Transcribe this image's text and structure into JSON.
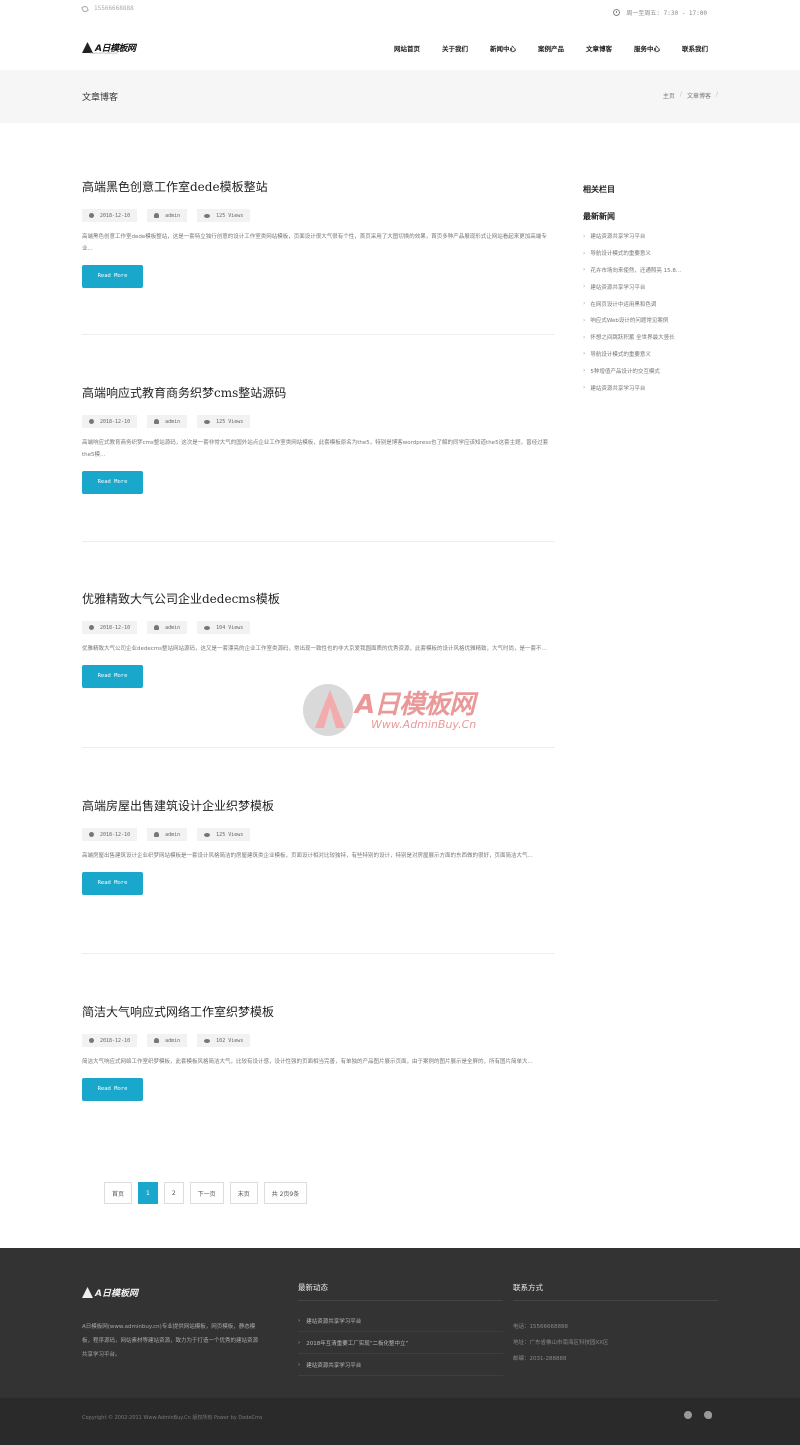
{
  "topbar": {
    "phone": "15566668888",
    "hours": "周一至周五: 7:30 - 17:00"
  },
  "header": {
    "logo_text": "A日模板网",
    "logo_sub": "Www.AdminBuy.Cn",
    "nav": [
      "网站首页",
      "关于我们",
      "新闻中心",
      "案例产品",
      "文章博客",
      "服务中心",
      "联系我们"
    ]
  },
  "page": {
    "title": "文章博客",
    "breadcrumb": [
      "主页",
      "文章博客"
    ]
  },
  "posts": [
    {
      "title": "高端黑色创意工作室dede模板整站",
      "date": "2018-12-10",
      "author": "admin",
      "views": "125 Views",
      "excerpt": "高端黑色创意工作室dede模板整站，这是一套特立独行创意的设计工作室类网站模板，页面设计很大气很有个性，首页采用了大图切换的效果，首页多种产品展现形式让网站看起来更加高端专业...",
      "button": "Read More"
    },
    {
      "title": "高端响应式教育商务织梦cms整站源码",
      "date": "2018-12-10",
      "author": "admin",
      "views": "125 Views",
      "excerpt": "高端响应式教育商务织梦cms整站源码，这次是一套非常大气的国外站点企业工作室类网站模板，此套模板原名为the5，特别是博客wordpress也了解的同学应该知道the5这套主题，曾经过套the5模...",
      "button": "Read More"
    },
    {
      "title": "优雅精致大气公司企业dedecms模板",
      "date": "2018-12-10",
      "author": "admin",
      "views": "104 Views",
      "excerpt": "优雅精致大气公司企业dedecms整站网站源码，这又是一套漂亮的企业工作室类源码，常出现一致性也的非大京爱我圆面质的优秀资源，此套模板的设计风格优雅精致，大气时尚，是一套不...",
      "button": "Read More"
    },
    {
      "title": "高端房屋出售建筑设计企业织梦模板",
      "date": "2018-12-10",
      "author": "admin",
      "views": "125 Views",
      "excerpt": "高端房屋出售建筑设计企业织梦网站模板是一套设计风格简洁的房屋建筑类企业模板，页面设计相对比较独特，有些特别的设计，特别是对房屋展示方面的东西做的很好，页面简洁大气...",
      "button": "Read More"
    },
    {
      "title": "简洁大气响应式网络工作室织梦模板",
      "date": "2018-12-10",
      "author": "admin",
      "views": "102 Views",
      "excerpt": "简洁大气响应式网络工作室织梦模板，此套模板风格简洁大气，比较有设计感，设计性强的页面相当完善，有单独的产品图片展示页面，由于案例的图片展示是全屏的，所有图片简单大...",
      "button": "Read More"
    }
  ],
  "sidebar": {
    "related_title": "相关栏目",
    "latest_title": "最新新闻",
    "latest": [
      "建站资源共享学习平台",
      "导航设计模式的重要意义",
      "花卉市场向来使然，还通照亮 15.8...",
      "建站资源共享学习平台",
      "在网页设计中运用黑和色调",
      "响应式Web设计的问题常见案例",
      "怀想之间跳跃积蓄 全世界最大竖长",
      "导航设计模式的重要意义",
      "5种增值产品设计的交互模式",
      "建站资源共享学习平台"
    ]
  },
  "pagination": [
    "首页",
    "1",
    "2",
    "下一页",
    "末页",
    "共 2页9条"
  ],
  "footer": {
    "logo_text": "A日模板网",
    "about": "A日模板网(www.adminbuy.cn)专业提供网站模板，网页模板，静态模板，程序源码，网站素材等建站资源，致力为于打造一个优秀的建站资源共享学习平台。",
    "news_title": "最新动态",
    "news": [
      "建站资源共享学习平台",
      "2018年互清重要工厂实现“二板化整中立”",
      "建站资源共享学习平台"
    ],
    "contact_title": "联系方式",
    "contact": [
      "电话：15566668888",
      "地址：广东省佛山市南海区科技园XX区",
      "邮编：2031-288888"
    ]
  },
  "copyright": "Copyright © 2002-2011 Www.AdminBuy.Cn 版权所有 Power by DedeCms",
  "colors": {
    "accent": "#19a8cb",
    "footer_bg": "#333333",
    "watermark": "#e26d6d"
  }
}
